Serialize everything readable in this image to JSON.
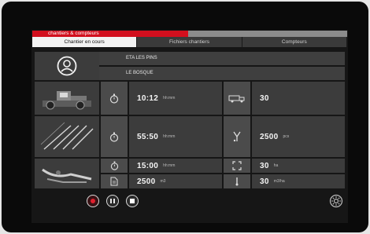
{
  "app": {
    "title": "chantiers & compteurs"
  },
  "tabs": [
    {
      "label": "Chantier en cours",
      "active": true
    },
    {
      "label": "Fichiers chantiers",
      "active": false
    },
    {
      "label": "Compteurs",
      "active": false
    }
  ],
  "info": {
    "line1": "ETA LES PINS",
    "line2": "LE BOSQUE"
  },
  "metrics": {
    "row1": {
      "value": "10:12",
      "unit": "hh:mm"
    },
    "row1_right": {
      "value": "30",
      "unit": ""
    },
    "row2": {
      "value": "55:50",
      "unit": "hh:mm"
    },
    "row2_right": {
      "value": "2500",
      "unit": "pcs"
    },
    "row3": {
      "value": "15:00",
      "unit": "hh:mm"
    },
    "row3_right": {
      "value": "30",
      "unit": "ha"
    },
    "row4": {
      "value": "2500",
      "unit": "m3"
    },
    "row4_right": {
      "value": "30",
      "unit": "m3/ha"
    }
  },
  "colors": {
    "accent": "#d20f1e",
    "panel": "#3c3c3c",
    "icon_panel": "#4b4b4b"
  },
  "icons": {
    "user": "user-avatar-icon",
    "timer": "stopwatch-icon",
    "truck": "truck-icon",
    "sprayer": "sprayer-icon",
    "area": "area-frame-icon",
    "volume": "document-icon",
    "rate": "gauge-needle-icon",
    "settings": "gear-icon"
  }
}
